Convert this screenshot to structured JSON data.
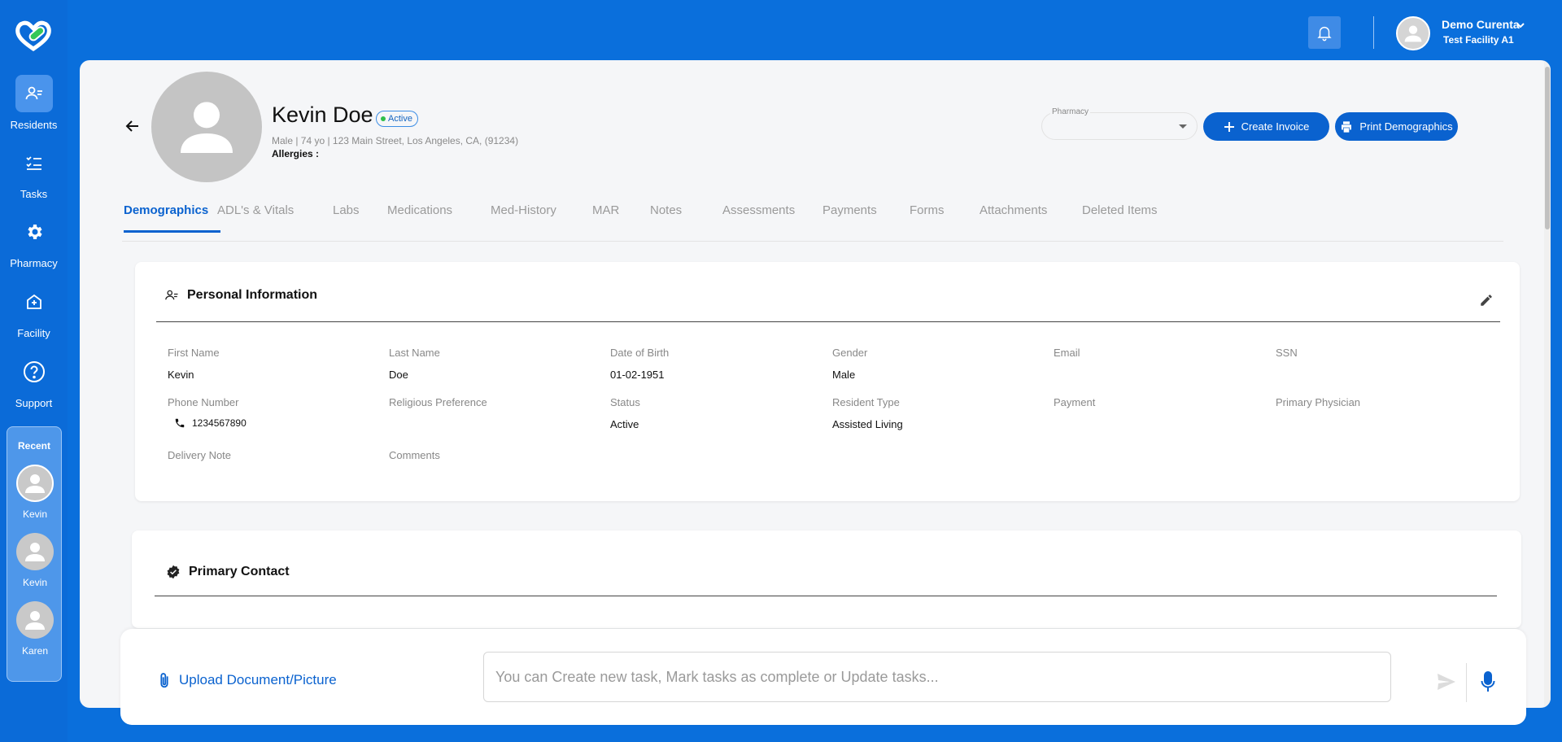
{
  "colors": {
    "brand": "#0a6fdc",
    "accent": "#0a62cf",
    "status_active": "#2fbf4a"
  },
  "sidebar": {
    "items": [
      {
        "label": "Residents",
        "icon": "residents-icon",
        "active": true
      },
      {
        "label": "Tasks",
        "icon": "tasks-icon",
        "active": false
      },
      {
        "label": "Pharmacy",
        "icon": "gear-icon",
        "active": false
      },
      {
        "label": "Facility",
        "icon": "facility-icon",
        "active": false
      },
      {
        "label": "Support",
        "icon": "help-icon",
        "active": false
      }
    ],
    "recent": {
      "title": "Recent",
      "items": [
        {
          "name": "Kevin"
        },
        {
          "name": "Kevin"
        },
        {
          "name": "Karen"
        }
      ]
    }
  },
  "header": {
    "user_name": "Demo Curenta",
    "facility": "Test Facility A1"
  },
  "resident": {
    "name": "Kevin Doe",
    "status": "Active",
    "meta": "Male | 74 yo | 123 Main Street, Los Angeles, CA, (91234)",
    "allergies": "Allergies :"
  },
  "actions": {
    "pharmacy_label": "Pharmacy",
    "pharmacy_value": "",
    "create_invoice": "Create Invoice",
    "print_demographics": "Print Demographics"
  },
  "tabs": [
    "Demographics",
    "ADL's & Vitals",
    "Labs",
    "Medications",
    "Med-History",
    "MAR",
    "Notes",
    "Assessments",
    "Payments",
    "Forms",
    "Attachments",
    "Deleted Items"
  ],
  "personal": {
    "title": "Personal Information",
    "fields": {
      "first_name": {
        "label": "First Name",
        "value": "Kevin"
      },
      "last_name": {
        "label": "Last Name",
        "value": "Doe"
      },
      "dob": {
        "label": "Date of Birth",
        "value": "01-02-1951"
      },
      "gender": {
        "label": "Gender",
        "value": "Male"
      },
      "email": {
        "label": "Email",
        "value": ""
      },
      "ssn": {
        "label": "SSN",
        "value": ""
      },
      "phone": {
        "label": "Phone Number",
        "value": "1234567890"
      },
      "religion": {
        "label": "Religious Preference",
        "value": ""
      },
      "status": {
        "label": "Status",
        "value": "Active"
      },
      "resident_type": {
        "label": "Resident Type",
        "value": "Assisted Living"
      },
      "payment": {
        "label": "Payment",
        "value": ""
      },
      "physician": {
        "label": "Primary Physician",
        "value": ""
      },
      "delivery_note": {
        "label": "Delivery Note",
        "value": ""
      },
      "comments": {
        "label": "Comments",
        "value": ""
      }
    }
  },
  "contact": {
    "title": "Primary Contact"
  },
  "bottom": {
    "upload_label": "Upload Document/Picture",
    "task_placeholder": "You can Create new task, Mark tasks as complete or Update tasks..."
  }
}
